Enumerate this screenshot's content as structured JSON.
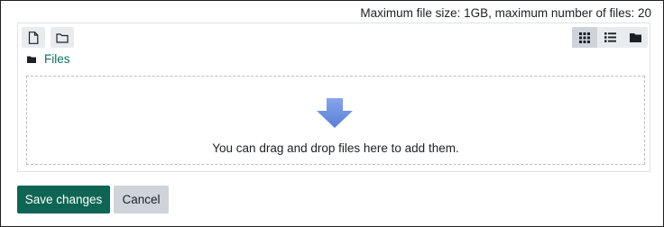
{
  "filemanager": {
    "limits_text": "Maximum file size: 1GB, maximum number of files: 20",
    "toolbar": {
      "add_file_icon": "file-icon",
      "create_folder_icon": "folder-outline-icon",
      "views": [
        {
          "icon": "grid-icon",
          "active": true
        },
        {
          "icon": "list-icon",
          "active": false
        },
        {
          "icon": "tree-folder-icon",
          "active": false
        }
      ]
    },
    "breadcrumb": {
      "icon": "folder-icon",
      "label": "Files"
    },
    "dropzone": {
      "icon": "down-arrow-icon",
      "text": "You can drag and drop files here to add them."
    }
  },
  "actions": {
    "save_label": "Save changes",
    "cancel_label": "Cancel"
  },
  "colors": {
    "primary": "#0f6554",
    "link": "#0f6e64",
    "arrow": "#6c8fdc",
    "secondary": "#ced4da"
  }
}
